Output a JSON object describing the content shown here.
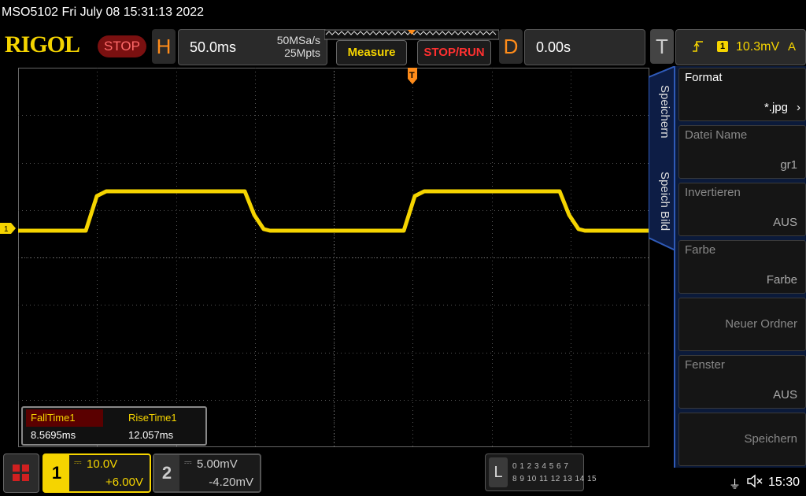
{
  "status_line": "MSO5102  Fri July 08 15:31:13 2022",
  "header": {
    "brand": "RIGOL",
    "run_state": "STOP",
    "horizontal": {
      "letter": "H",
      "timebase": "50.0ms",
      "sample_rate": "50MSa/s",
      "memory_depth": "25Mpts"
    },
    "measure_button": "Measure",
    "stoprun_button": "STOP/RUN",
    "delay": {
      "letter": "D",
      "value": "0.00s"
    },
    "trigger": {
      "letter": "T",
      "source": "1",
      "level": "10.3mV",
      "mode": "A"
    }
  },
  "colors": {
    "ch1": "#f5d400",
    "accent_orange": "#ff8c1a",
    "stop_red": "#ff3030",
    "menu_blue": "#2f5ab8"
  },
  "channel_marker": "1",
  "trigger_marker": "T",
  "side_tabs": [
    "Speichern",
    "Speich Bild"
  ],
  "side_menu": [
    {
      "label": "Format",
      "value": "*.jpg"
    },
    {
      "label": "Datei Name",
      "value": "gr1"
    },
    {
      "label": "Invertieren",
      "value": "AUS"
    },
    {
      "label": "Farbe",
      "value": "Farbe"
    },
    {
      "label": "Neuer Ordner",
      "value": ""
    },
    {
      "label": "Fenster",
      "value": "AUS"
    },
    {
      "label": "Speichern",
      "value": ""
    }
  ],
  "measurements": [
    {
      "name": "FallTime1",
      "value": "8.5695ms"
    },
    {
      "name": "RiseTime1",
      "value": "12.057ms"
    }
  ],
  "channels": [
    {
      "num": "1",
      "scale": "10.0V",
      "offset": "+6.00V"
    },
    {
      "num": "2",
      "scale": "5.00mV",
      "offset": "-4.20mV"
    }
  ],
  "logic_analyzer": {
    "letter": "L",
    "row1": "0 1 2 3  4 5 6 7",
    "row2": "8  9 10 11 12 13 14 15"
  },
  "clock": "15:30",
  "waveform": {
    "description_units": "time in ms relative to screen left, volts on ch1",
    "period_ms": 200,
    "low_level": 0,
    "high_level": 1
  }
}
